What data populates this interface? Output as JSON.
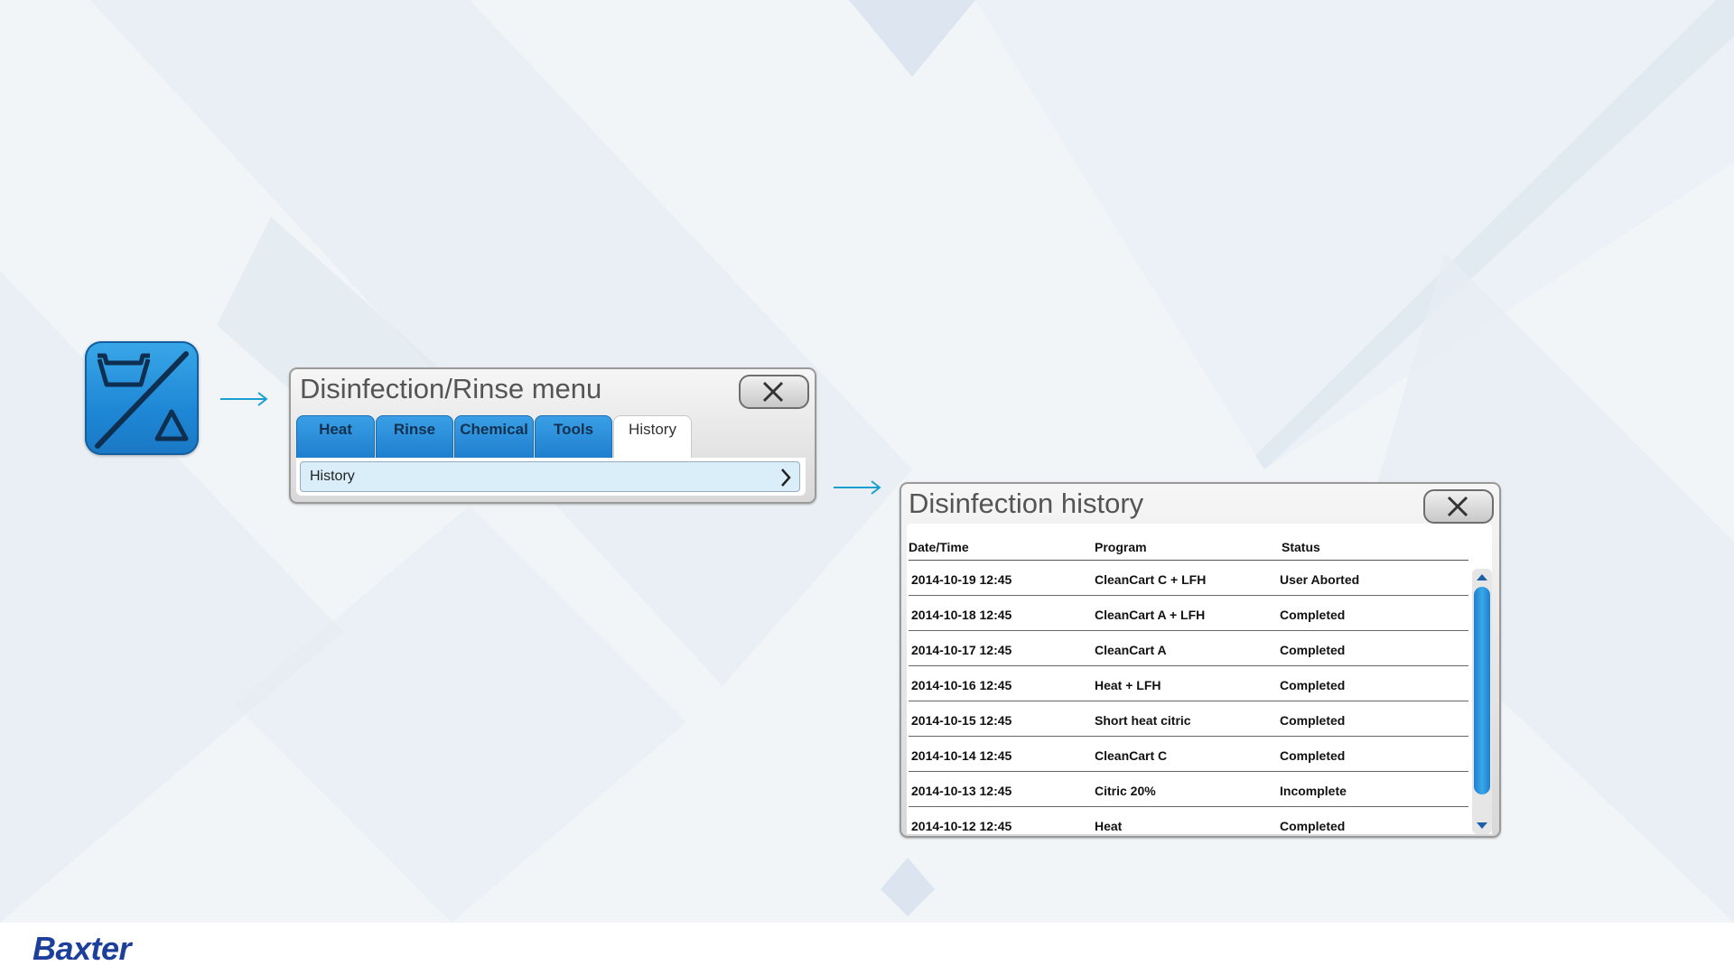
{
  "brand": {
    "name": "Baxter"
  },
  "menu_window": {
    "title": "Disinfection/Rinse menu",
    "tabs": [
      {
        "label": "Heat",
        "active": false
      },
      {
        "label": "Rinse",
        "active": false
      },
      {
        "label": "Chemical",
        "active": false
      },
      {
        "label": "Tools",
        "active": false
      },
      {
        "label": "History",
        "active": true
      }
    ],
    "items": [
      {
        "label": "History"
      }
    ]
  },
  "history_window": {
    "title": "Disinfection history",
    "columns": [
      "Date/Time",
      "Program",
      "Status"
    ],
    "rows": [
      {
        "datetime": "2014-10-19 12:45",
        "program": "CleanCart C + LFH",
        "status": "User Aborted"
      },
      {
        "datetime": "2014-10-18 12:45",
        "program": "CleanCart A + LFH",
        "status": "Completed"
      },
      {
        "datetime": "2014-10-17 12:45",
        "program": "CleanCart A",
        "status": "Completed"
      },
      {
        "datetime": "2014-10-16 12:45",
        "program": "Heat + LFH",
        "status": "Completed"
      },
      {
        "datetime": "2014-10-15 12:45",
        "program": "Short heat citric",
        "status": "Completed"
      },
      {
        "datetime": "2014-10-14 12:45",
        "program": "CleanCart C",
        "status": "Completed"
      },
      {
        "datetime": "2014-10-13 12:45",
        "program": "Citric 20%",
        "status": "Incomplete"
      },
      {
        "datetime": "2014-10-12 12:45",
        "program": "Heat",
        "status": "Completed"
      }
    ]
  },
  "colors": {
    "accent": "#1f88d6",
    "brand": "#1b3f9a",
    "arrow": "#1a9fcf"
  },
  "icons": [
    "disinfection-rinse-icon",
    "arrow-right-icon",
    "close-icon",
    "chevron-right-icon",
    "scroll-up-icon",
    "scroll-down-icon"
  ]
}
